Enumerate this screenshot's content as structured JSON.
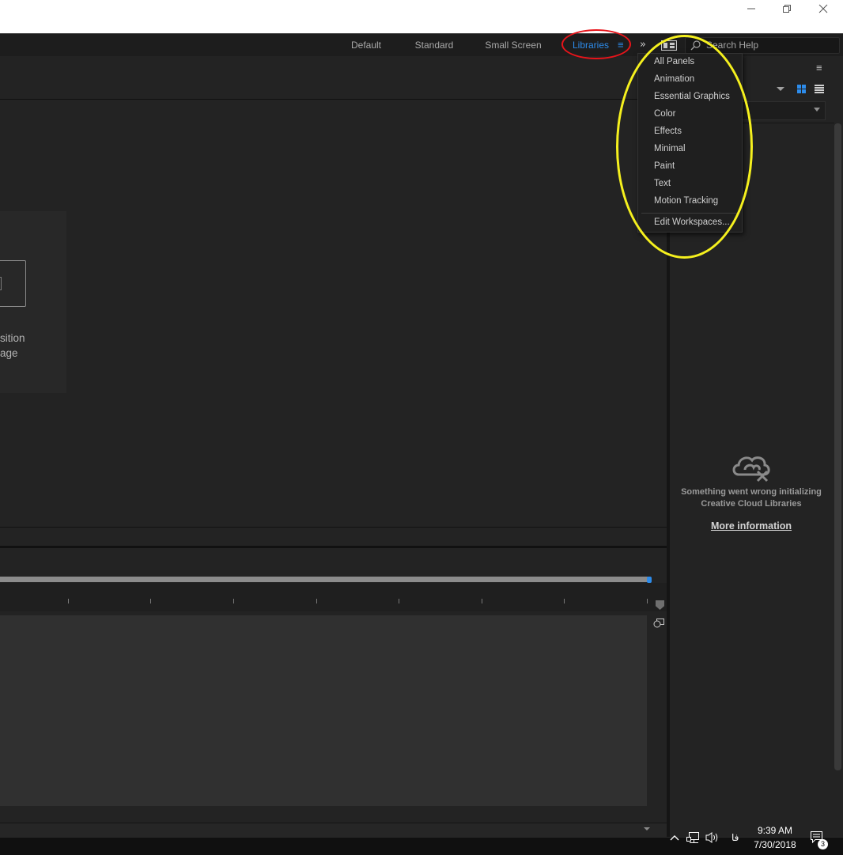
{
  "window": {
    "controls": {
      "minimize": "minimize-icon",
      "restore": "restore-icon",
      "close": "close-icon"
    }
  },
  "workspace_bar": {
    "tabs": [
      {
        "label": "Default"
      },
      {
        "label": "Standard"
      },
      {
        "label": "Small Screen"
      },
      {
        "label": "Libraries",
        "active": true
      }
    ],
    "menu_icon": "≡",
    "overflow_icon": "»",
    "search": {
      "placeholder": "Search Help"
    }
  },
  "workspace_menu": {
    "items": [
      "All Panels",
      "Animation",
      "Essential Graphics",
      "Color",
      "Effects",
      "Minimal",
      "Paint",
      "Text",
      "Motion Tracking"
    ],
    "footer_item": "Edit Workspaces..."
  },
  "composition_panel": {
    "text_line1": "sition",
    "text_line2": "age"
  },
  "libraries_panel": {
    "menu_icon": "≡",
    "error_line1": "Something went wrong initializing",
    "error_line2": "Creative Cloud Libraries",
    "more_info": "More information"
  },
  "taskbar": {
    "time": "9:39 AM",
    "date": "7/30/2018",
    "language": "فا",
    "notification_count": "3"
  },
  "colors": {
    "accent": "#2d8ceb",
    "annotation_red": "#e8141a",
    "annotation_yellow": "#f5f01e",
    "panel_bg": "#232323"
  }
}
